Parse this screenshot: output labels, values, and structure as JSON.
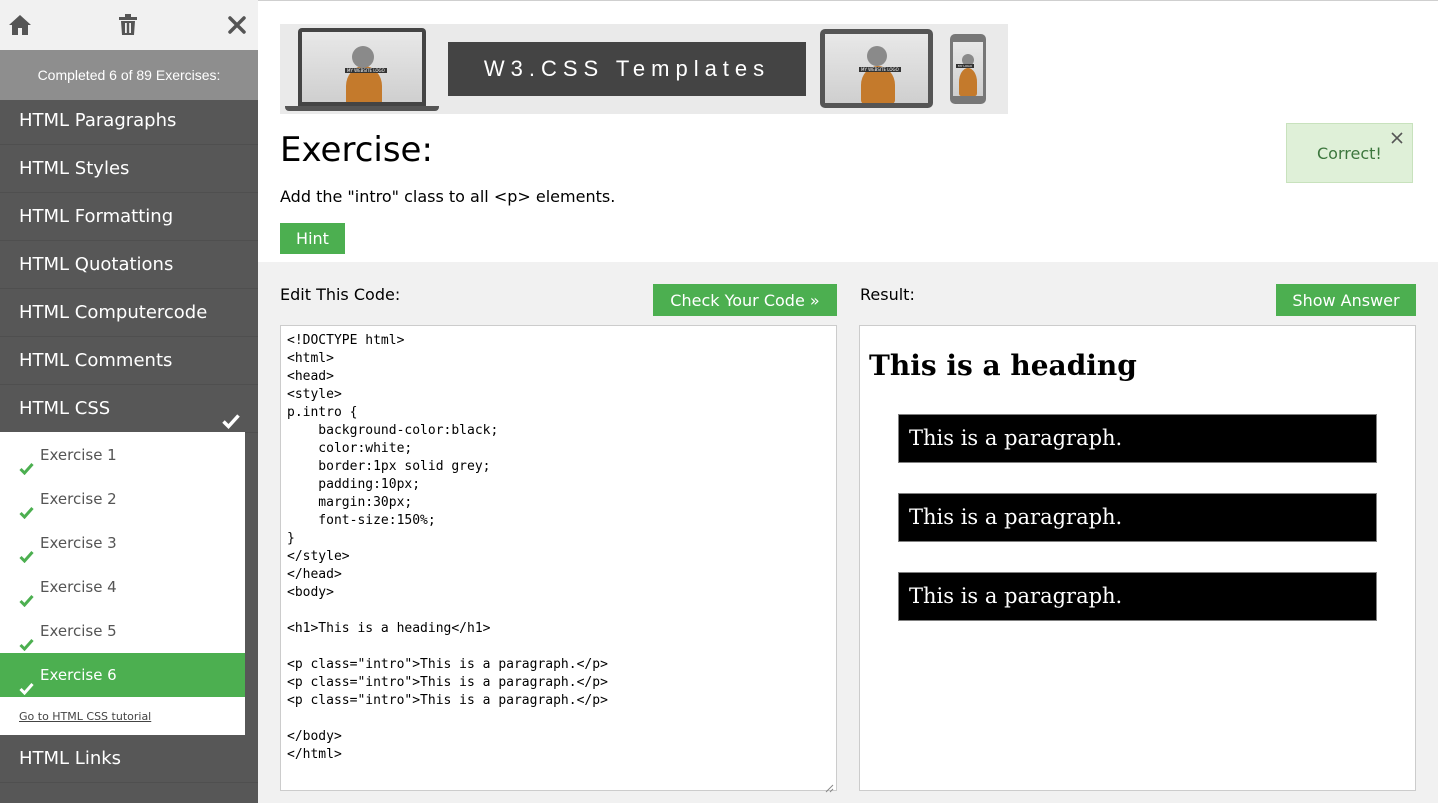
{
  "sidebar": {
    "progress_text": "Completed 6 of 89 Exercises:",
    "nav_items": [
      {
        "label": "HTML Paragraphs"
      },
      {
        "label": "HTML Styles"
      },
      {
        "label": "HTML Formatting"
      },
      {
        "label": "HTML Quotations"
      },
      {
        "label": "HTML Computercode"
      },
      {
        "label": "HTML Comments"
      },
      {
        "label": "HTML CSS",
        "active": true,
        "completed": true
      }
    ],
    "exercises": [
      {
        "label": "Exercise 1",
        "done": true
      },
      {
        "label": "Exercise 2",
        "done": true
      },
      {
        "label": "Exercise 3",
        "done": true
      },
      {
        "label": "Exercise 4",
        "done": true
      },
      {
        "label": "Exercise 5",
        "done": true
      },
      {
        "label": "Exercise 6",
        "done": true,
        "current": true
      }
    ],
    "tutorial_link": "Go to HTML CSS tutorial",
    "next_items": [
      {
        "label": "HTML Links"
      }
    ],
    "icons": [
      "home-icon",
      "trash-icon",
      "close-icon"
    ]
  },
  "banner": {
    "title": "W3.CSS Templates",
    "mockup_label_large": "MY WEBSITE LOGO",
    "mockup_label_small": "MY LOGO"
  },
  "exercise": {
    "title": "Exercise:",
    "description": "Add the \"intro\" class to all <p> elements.",
    "hint_label": "Hint"
  },
  "feedback": {
    "message": "Correct!"
  },
  "editor": {
    "label": "Edit This Code:",
    "check_label": "Check Your Code »",
    "code_lines": [
      "<!DOCTYPE html>",
      "<html>",
      "<head>",
      "<style>",
      "p.intro {",
      "    background-color:black;",
      "    color:white;",
      "    border:1px solid grey;",
      "    padding:10px;",
      "    margin:30px;",
      "    font-size:150%;",
      "}",
      "</style>",
      "</head>",
      "<body>",
      "",
      "<h1>This is a heading</h1>",
      "",
      "<p class=\"intro\">This is a paragraph.</p>",
      "<p class=\"intro\">This is a paragraph.</p>",
      "<p class=\"intro\">This is a paragraph.</p>",
      "",
      "</body>",
      "</html>"
    ]
  },
  "result": {
    "label": "Result:",
    "answer_label": "Show Answer",
    "heading": "This is a heading",
    "paragraphs": [
      "This is a paragraph.",
      "This is a paragraph.",
      "This is a paragraph."
    ]
  },
  "colors": {
    "accent_green": "#4caf50",
    "sidebar_bg": "#575757",
    "correct_bg": "#dff0d8",
    "correct_text": "#3c763d"
  }
}
